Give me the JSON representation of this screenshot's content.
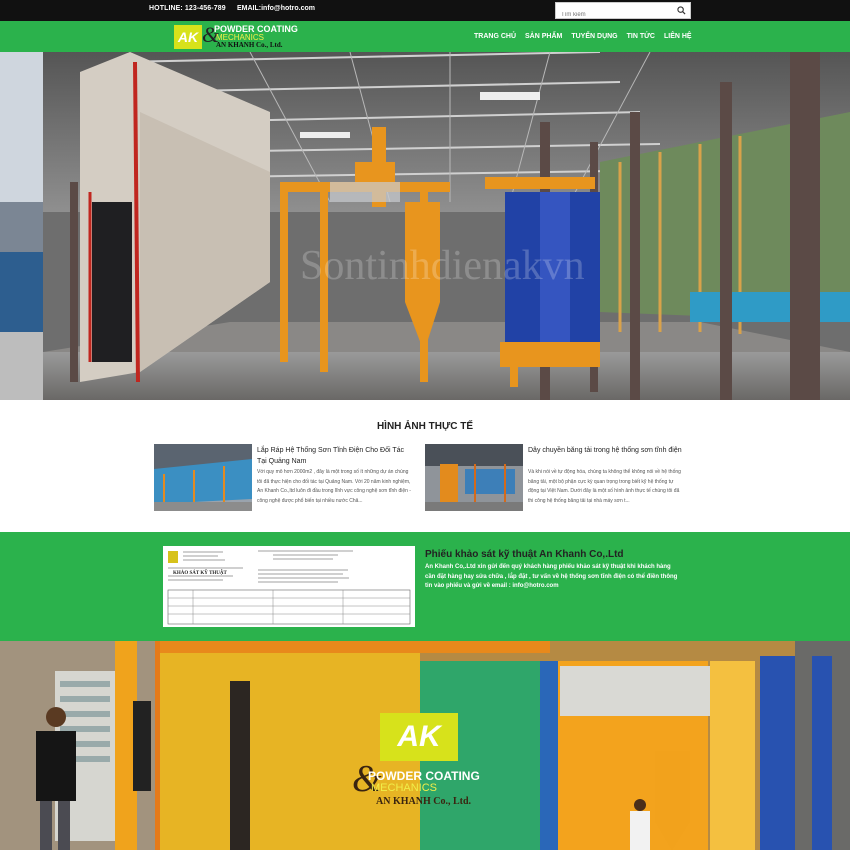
{
  "topbar": {
    "hotline": "HOTLINE: 123-456-789",
    "email": "EMAIL:info@hotro.com",
    "search_placeholder": "Tìm kiếm"
  },
  "logo": {
    "ak": "AK",
    "ampersand": "&",
    "line1": "POWDER COATING",
    "line2": "MECHANICS",
    "line3": "AN KHANH Co., Ltd."
  },
  "nav": {
    "items": [
      "TRANG CHỦ",
      "SẢN PHẨM",
      "TUYỂN DỤNG",
      "TIN TỨC",
      "LIÊN HỆ"
    ]
  },
  "hero": {
    "watermark": "Sontinhdienakvn"
  },
  "section": {
    "title": "HÌNH ẢNH THỰC TẾ",
    "items": [
      {
        "title": "Lắp Ráp Hệ Thống Sơn Tĩnh Điện Cho Đối Tác Tại Quảng Nam",
        "desc": "Với quy mô hơn 2000m2 , đây là một trong số ít những dự án chúng tôi đã thực hiện cho đối tác tại Quảng Nam. Với 20 năm kinh nghiệm, An Khanh Co.,ltd luôn đi đầu trong lĩnh vực công nghệ sơn tĩnh điện - công nghệ được phổ biến tại nhiều nước Châ..."
      },
      {
        "title": "Dây chuyền băng tải trong hệ thống sơn tĩnh điện",
        "desc": "Và khi nói về tự động hóa, chúng ta không thể không nói về hệ thống băng tải, một bộ phận cực kỳ quan trọng trong biết kỹ hệ thống tự động tại Việt Nam. Dưới đây là một số hình ảnh thực tế chúng tôi đã thi công hệ thống băng tải tại nhà máy sơn t..."
      }
    ]
  },
  "survey": {
    "title": "Phiếu khảo sát kỹ thuật An Khanh Co,.Ltd",
    "desc": "An Khanh Co,.Ltd xin gửi đến quý khách hàng phiếu khảo sát kỹ thuật khi khách hàng cần đặt hàng hay sửa chữa , lắp đặt , tư vấn về hệ thống sơn tĩnh điện có thể điền thông tin vào phiếu và gửi về email : info@hotro.com",
    "doc_header": "KHẢO SÁT KỸ THUẬT"
  },
  "colors": {
    "green": "#2bb24c",
    "topbar": "#111111",
    "logo_yellow": "#d7e21b"
  }
}
